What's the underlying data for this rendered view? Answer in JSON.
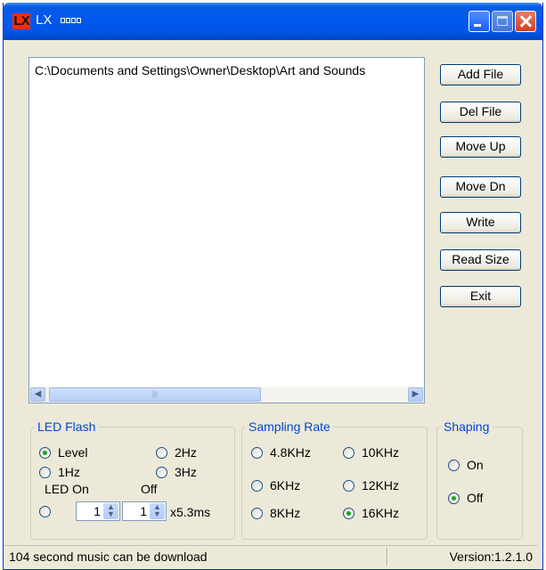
{
  "window": {
    "title": "LX",
    "icon_label": "LX"
  },
  "file_list": {
    "items": [
      "C:\\Documents and Settings\\Owner\\Desktop\\Art and Sounds"
    ]
  },
  "buttons": {
    "add_file": "Add File",
    "del_file": "Del File",
    "move_up": "Move Up",
    "move_dn": "Move Dn",
    "write": "Write",
    "read_size": "Read Size",
    "exit": "Exit"
  },
  "led_flash": {
    "title": "LED Flash",
    "level": "Level",
    "hz2": "2Hz",
    "hz1": "1Hz",
    "hz3": "3Hz",
    "led_on_label": "LED  On",
    "off_label": "Off",
    "on_value": "1",
    "off_value": "1",
    "unit": "x5.3ms",
    "selected": "Level"
  },
  "sampling_rate": {
    "title": "Sampling Rate",
    "options": [
      "4.8KHz",
      "10KHz",
      "6KHz",
      "12KHz",
      "8KHz",
      "16KHz"
    ],
    "selected": "16KHz"
  },
  "shaping": {
    "title": "Shaping",
    "on": "On",
    "off": "Off",
    "selected": "Off"
  },
  "status": {
    "message": "104 second music can be download",
    "version": "Version:1.2.1.0"
  },
  "colors": {
    "titlebar": "#0058ee",
    "window_bg": "#ece9d8",
    "group_title": "#0046d5",
    "radio_selected": "#21a121"
  }
}
